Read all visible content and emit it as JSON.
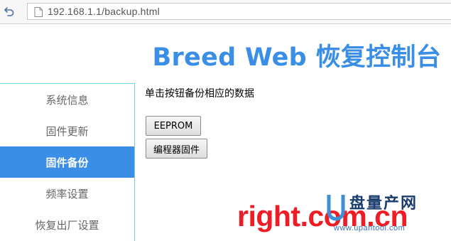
{
  "browser": {
    "url": "192.168.1.1/backup.html",
    "back_icon": "back-arrow-icon",
    "page_icon": "page-icon"
  },
  "page": {
    "title": "Breed Web 恢复控制台"
  },
  "sidebar": {
    "items": [
      {
        "label": "系统信息",
        "active": false
      },
      {
        "label": "固件更新",
        "active": false
      },
      {
        "label": "固件备份",
        "active": true
      },
      {
        "label": "频率设置",
        "active": false
      },
      {
        "label": "恢复出厂设置",
        "active": false
      }
    ]
  },
  "main": {
    "instruction": "单击按钮备份相应的数据",
    "buttons": [
      {
        "label": "EEPROM"
      },
      {
        "label": "编程器固件"
      }
    ]
  },
  "watermark": {
    "brand": "right.com.cn",
    "cn_text": "盘量产网",
    "url": "www.upantool.com"
  },
  "colors": {
    "accent": "#3a8ee6",
    "sidebar_border": "#6fd6dc",
    "watermark_red": "#ee1c25",
    "watermark_navy": "#1a3d6e"
  }
}
